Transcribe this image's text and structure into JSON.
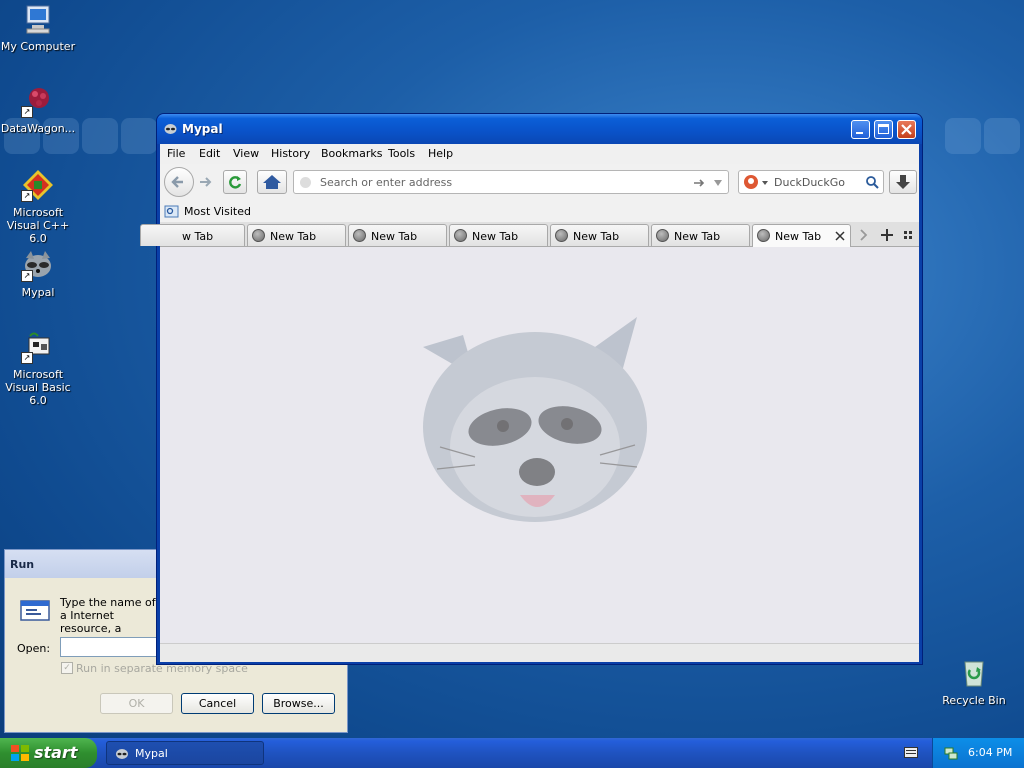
{
  "desktop": {
    "icons": [
      {
        "label": "My Computer"
      },
      {
        "label": "DataWagon..."
      },
      {
        "label": "Microsoft Visual C++ 6.0"
      },
      {
        "label": "Mypal"
      },
      {
        "label": "Microsoft Visual Basic 6.0"
      },
      {
        "label": "Recycle Bin"
      }
    ]
  },
  "window": {
    "title": "Mypal",
    "menu": [
      "File",
      "Edit",
      "View",
      "History",
      "Bookmarks",
      "Tools",
      "Help"
    ],
    "address_placeholder": "Search or enter address",
    "search_engine": "DuckDuckGo",
    "bookmarks_toolbar": {
      "item": "Most Visited"
    },
    "tabs": [
      {
        "label": "w Tab"
      },
      {
        "label": "New Tab"
      },
      {
        "label": "New Tab"
      },
      {
        "label": "New Tab"
      },
      {
        "label": "New Tab"
      },
      {
        "label": "New Tab"
      },
      {
        "label": "New Tab"
      }
    ],
    "active_tab_index": 6
  },
  "run_dialog": {
    "title": "Run",
    "description": "Type the name of a Internet resource, a",
    "open_label": "Open:",
    "open_value": "",
    "checkbox_label": "Run in separate memory space",
    "checkbox_checked": true,
    "ok_label": "OK",
    "cancel_label": "Cancel",
    "browse_label": "Browse..."
  },
  "taskbar": {
    "start_label": "start",
    "task_label": "Mypal",
    "clock": "6:04 PM"
  }
}
